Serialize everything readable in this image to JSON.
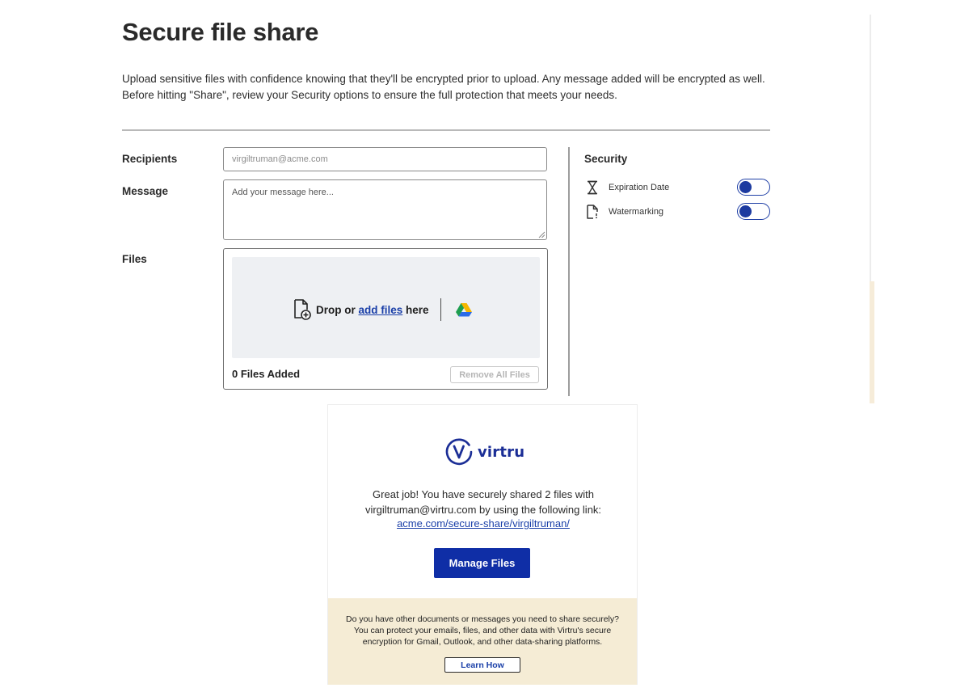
{
  "page": {
    "title": "Secure file share",
    "intro": "Upload sensitive files with confidence knowing that they'll be encrypted prior to upload.  Any message added will be encrypted as well.  Before hitting \"Share\", review your Security options to ensure the full protection that meets your needs."
  },
  "form": {
    "recipients_label": "Recipients",
    "recipients_placeholder": "virgiltruman@acme.com",
    "recipients_value": "",
    "message_label": "Message",
    "message_placeholder": "Add your message here...",
    "message_value": "",
    "files_label": "Files",
    "drop_prefix": "Drop or ",
    "drop_link": "add files",
    "drop_suffix": " here",
    "files_count": "0 Files Added",
    "remove_all_label": "Remove All Files"
  },
  "security": {
    "title": "Security",
    "options": [
      {
        "label": "Expiration Date",
        "icon": "hourglass-icon",
        "enabled": false
      },
      {
        "label": "Watermarking",
        "icon": "document-watermark-icon",
        "enabled": false
      }
    ]
  },
  "email": {
    "brand": "virtru",
    "success_line1": "Great job! You have securely shared 2 files with",
    "success_line2": "virgiltruman@virtru.com by using the following link:",
    "share_link": "acme.com/secure-share/virgiltruman/",
    "manage_button": "Manage Files",
    "promo_line1": "Do you have other documents or messages you need to share securely?",
    "promo_line2": "You can protect your emails, files, and other data with Virtru's secure",
    "promo_line3": "encryption for Gmail, Outlook, and other data-sharing platforms.",
    "learn_button": "Learn How"
  },
  "colors": {
    "brand_blue": "#0f2ea6",
    "link_blue": "#1a3fa8",
    "promo_bg": "#f5ecd5",
    "dropzone_bg": "#eef0f3"
  }
}
